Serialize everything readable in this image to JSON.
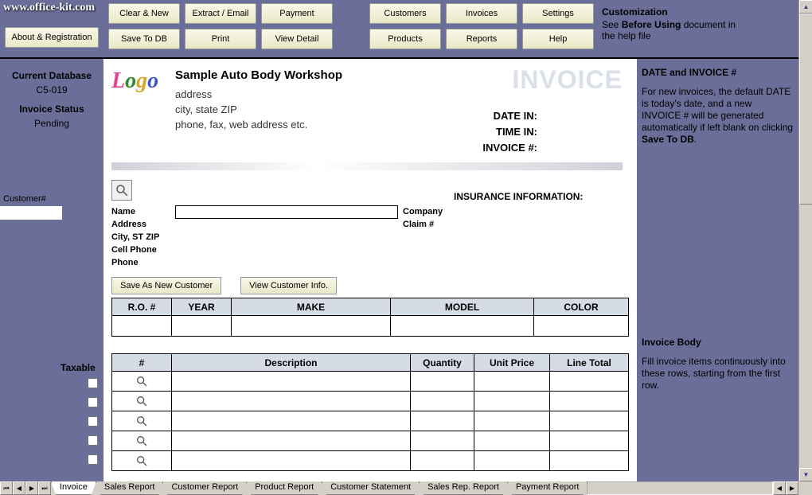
{
  "url": "www.office-kit.com",
  "toolbar": {
    "about": "About & Registration",
    "row1": [
      "Clear & New",
      "Extract / Email",
      "Payment"
    ],
    "row2": [
      "Save To DB",
      "Print",
      "View Detail"
    ],
    "row3": [
      "Customers",
      "Invoices",
      "Settings"
    ],
    "row4": [
      "Products",
      "Reports",
      "Help"
    ]
  },
  "help_top": {
    "title": "Customization",
    "line1": "See ",
    "bold": "Before Using",
    "line2": " document in the help file"
  },
  "left": {
    "db_label": "Current Database",
    "db_value": "C5-019",
    "status_label": "Invoice Status",
    "status_value": "Pending",
    "customer_label": "Customer#",
    "taxable_label": "Taxable"
  },
  "company": {
    "name": "Sample Auto Body Workshop",
    "addr1": "address",
    "addr2": "city, state ZIP",
    "addr3": "phone, fax, web address etc."
  },
  "invoice_title": "INVOICE",
  "dates": {
    "date_in": "DATE IN:",
    "time_in": "TIME IN:",
    "invoice_no": "INVOICE #:"
  },
  "cust_fields": {
    "name": "Name",
    "address": "Address",
    "csz": "City, ST ZIP",
    "cell": "Cell Phone",
    "phone": "Phone"
  },
  "ins": {
    "header": "INSURANCE INFORMATION:",
    "company": "Company",
    "claim": "Claim #"
  },
  "cust_buttons": {
    "save": "Save As New Customer",
    "view": "View Customer Info."
  },
  "vehicle_headers": [
    "R.O. #",
    "YEAR",
    "MAKE",
    "MODEL",
    "COLOR"
  ],
  "item_headers": [
    "#",
    "Description",
    "Quantity",
    "Unit Price",
    "Line Total"
  ],
  "right": {
    "h1": "DATE and INVOICE #",
    "p1a": "For new invoices, the default DATE is today's date, and a new INVOICE # will be generated automatically if left blank  on clicking ",
    "p1b": "Save To DB",
    "h2": "Invoice Body",
    "p2": "Fill invoice items continuously into these rows, starting from the first row."
  },
  "tabs": [
    "Invoice",
    "Sales Report",
    "Customer Report",
    "Product Report",
    "Customer Statement",
    "Sales Rep. Report",
    "Payment Report"
  ]
}
